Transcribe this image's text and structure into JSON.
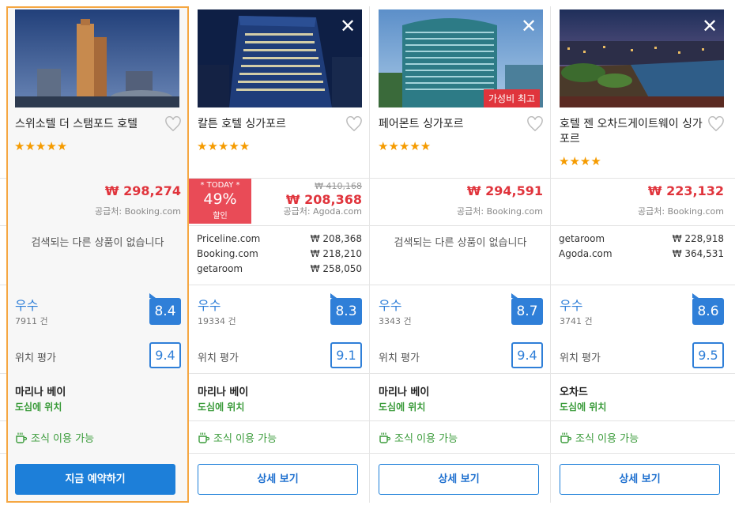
{
  "hotels": [
    {
      "name": "스위소텔 더 스탬포드 호텔",
      "stars": "★★★★★",
      "price": "₩ 298,274",
      "supplier": "공급처: Booking.com",
      "no_offers": "검색되는 다른 상품이 없습니다",
      "grade": "우수",
      "reviews": "7911 건",
      "score": "8.4",
      "location_label": "위치 평가",
      "location_score": "9.4",
      "area": "마리나 베이",
      "area_note": "도심에 위치",
      "breakfast": "조식 이용 가능",
      "button": "지금 예약하기"
    },
    {
      "name": "칼튼 호텔 싱가포르",
      "stars": "★★★★★",
      "today_badge": {
        "label": "* TODAY *",
        "percent": "49%",
        "suffix": "할인"
      },
      "old_price": "₩ 410,168",
      "price": "₩ 208,368",
      "supplier": "공급처: Agoda.com",
      "offers": [
        {
          "site": "Priceline.com",
          "amount": "₩ 208,368"
        },
        {
          "site": "Booking.com",
          "amount": "₩ 218,210"
        },
        {
          "site": "getaroom",
          "amount": "₩ 258,050"
        }
      ],
      "grade": "우수",
      "reviews": "19334 건",
      "score": "8.3",
      "location_label": "위치 평가",
      "location_score": "9.1",
      "area": "마리나 베이",
      "area_note": "도심에 위치",
      "breakfast": "조식 이용 가능",
      "button": "상세 보기"
    },
    {
      "name": "페어몬트 싱가포르",
      "stars": "★★★★★",
      "tag": "가성비 최고",
      "price": "₩ 294,591",
      "supplier": "공급처: Booking.com",
      "no_offers": "검색되는 다른 상품이 없습니다",
      "grade": "우수",
      "reviews": "3343 건",
      "score": "8.7",
      "location_label": "위치 평가",
      "location_score": "9.4",
      "area": "마리나 베이",
      "area_note": "도심에 위치",
      "breakfast": "조식 이용 가능",
      "button": "상세 보기"
    },
    {
      "name": "호텔 젠 오차드게이트웨이 싱가포르",
      "stars": "★★★★",
      "price": "₩ 223,132",
      "supplier": "공급처: Booking.com",
      "offers": [
        {
          "site": "getaroom",
          "amount": "₩ 228,918"
        },
        {
          "site": "Agoda.com",
          "amount": "₩ 364,531"
        }
      ],
      "grade": "우수",
      "reviews": "3741 건",
      "score": "8.6",
      "location_label": "위치 평가",
      "location_score": "9.5",
      "area": "오차드",
      "area_note": "도심에 위치",
      "breakfast": "조식 이용 가능",
      "button": "상세 보기"
    }
  ],
  "close_glyph": "✕",
  "colors": {
    "accent_blue": "#1d7fd9",
    "price_red": "#e0343c",
    "star": "#f59b00",
    "green": "#3a9b3a",
    "selected_border": "#f5a742"
  }
}
